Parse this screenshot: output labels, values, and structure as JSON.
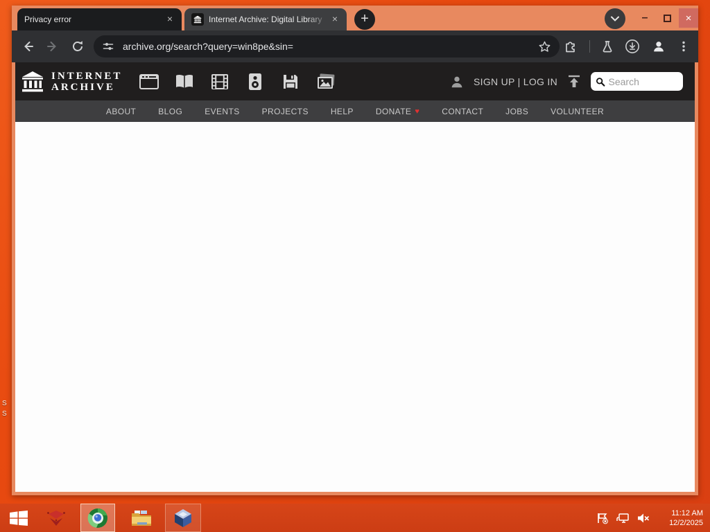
{
  "desktop": {
    "fragments": [
      "S",
      "S"
    ]
  },
  "browser": {
    "tabs": [
      {
        "title": "Privacy error"
      },
      {
        "title": "Internet Archive: Digital Library"
      }
    ],
    "new_tab_label": "+",
    "close_glyph": "×",
    "minimize_glyph": "–",
    "url": "archive.org/search?query=win8pe&sin="
  },
  "ia": {
    "wordmark": [
      "INTERNET",
      "ARCHIVE"
    ],
    "auth": "SIGN UP | LOG IN",
    "search_placeholder": "Search",
    "nav": [
      "ABOUT",
      "BLOG",
      "EVENTS",
      "PROJECTS",
      "HELP",
      "DONATE",
      "CONTACT",
      "JOBS",
      "VOLUNTEER"
    ]
  },
  "taskbar": {
    "clock": {
      "time": "11:12 AM",
      "date": "12/2/2025"
    }
  },
  "colors": {
    "desktop_orange": "#e84a10",
    "window_frame": "#e8895f",
    "donate_heart": "#e03131",
    "close_button": "#d06a60"
  }
}
